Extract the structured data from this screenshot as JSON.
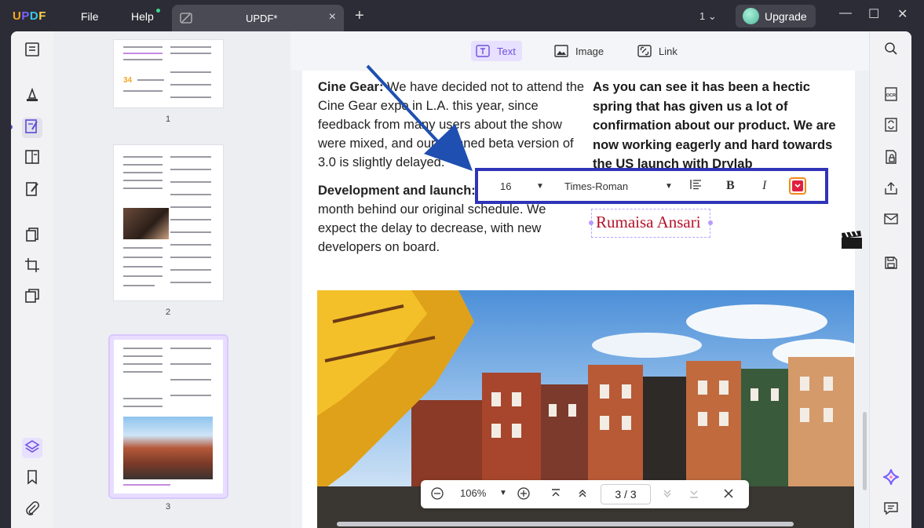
{
  "titlebar": {
    "logo": "UPDF",
    "menu_file": "File",
    "menu_help": "Help",
    "tab_title": "UPDF*",
    "tab_close": "×",
    "tab_add": "+",
    "window_count": "1",
    "upgrade_label": "Upgrade",
    "minimize": "—",
    "maximize": "☐",
    "close": "✕"
  },
  "edit_toolbar": {
    "text_label": "Text",
    "image_label": "Image",
    "link_label": "Link"
  },
  "thumbnails": {
    "pages": [
      "1",
      "2",
      "3"
    ],
    "selected": "3"
  },
  "document": {
    "left_col_p1_bold": "Cine Gear:",
    "left_col_p1": "We have decided not to attend the Cine Gear expo in L.A. this year, since feedback from many users about the show were mixed, and our planned beta version of 3.0 is slightly delayed.",
    "left_col_p2_bold": "Development and launch:",
    "left_col_p2": "is around one month behind our original schedule. We expect the delay to decrease, with new developers on board.",
    "right_col_text": "As you can see it has been a hectic spring that has given us a lot of confirmation about our product. We are now working eagerly and hard towards the US launch with Drylab",
    "signature_text": "Rumaisa Ansari"
  },
  "format_bar": {
    "font_size": "16",
    "font_family": "Times-Roman",
    "bold_label": "B",
    "italic_label": "I",
    "color": "#e02040"
  },
  "bottom_bar": {
    "zoom": "106%",
    "page_current": "3",
    "page_sep": "/",
    "page_total": "3"
  },
  "colors": {
    "accent": "#6a52e0",
    "highlight_border": "#2f34b8",
    "signature_color": "#b3132b",
    "arrow": "#1f4fb0"
  }
}
